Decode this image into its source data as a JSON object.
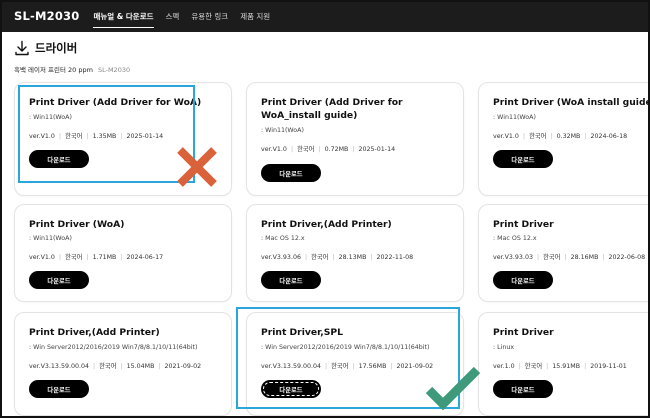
{
  "nav": {
    "brand": "SL-M2030",
    "items": [
      "매뉴얼 & 다운로드",
      "스펙",
      "유용한 링크",
      "제품 지원"
    ]
  },
  "section": {
    "title": "드라이버",
    "icon": "download-icon",
    "subtitle": "흑백 레이저 프린터 20 ppm",
    "model": "SL-M2030"
  },
  "cards": [
    {
      "title": "Print Driver (Add Driver for WoA)",
      "os": ": Win11(WoA)",
      "version": "ver.V1.0",
      "lang": "한국어",
      "size": "1.35MB",
      "date": "2025-01-14",
      "button": "다운로드"
    },
    {
      "title": "Print Driver (Add Driver for WoA_install guide)",
      "os": ": Win11(WoA)",
      "version": "ver.V1.0",
      "lang": "한국어",
      "size": "0.72MB",
      "date": "2025-01-14",
      "button": "다운로드"
    },
    {
      "title": "Print Driver (WoA install guide)",
      "os": ": Win11(WoA)",
      "version": "ver.V1.0",
      "lang": "한국어",
      "size": "0.32MB",
      "date": "2024-06-18",
      "button": "다운로드"
    },
    {
      "title": "Print Driver (WoA)",
      "os": ": Win11(WoA)",
      "version": "ver.V1.0",
      "lang": "한국어",
      "size": "1.71MB",
      "date": "2024-06-17",
      "button": "다운로드"
    },
    {
      "title": "Print Driver,(Add Printer)",
      "os": ": Mac OS 12.x",
      "version": "ver.V3.93.06",
      "lang": "한국어",
      "size": "28.13MB",
      "date": "2022-11-08",
      "button": "다운로드"
    },
    {
      "title": "Print Driver",
      "os": ": Mac OS 12.x",
      "version": "ver.V3.93.03",
      "lang": "한국어",
      "size": "28.16MB",
      "date": "2022-06-08",
      "button": "다운로드"
    },
    {
      "title": "Print Driver,(Add Printer)",
      "os": ": Win Server2012/2016/2019 Win7/8/8.1/10/11(64bit)",
      "version": "ver.V3.13.59.00.04",
      "lang": "한국어",
      "size": "15.04MB",
      "date": "2021-09-02",
      "button": "다운로드"
    },
    {
      "title": "Print Driver,SPL",
      "os": ": Win Server2012/2016/2019 Win7/8/8.1/10/11(64bit)",
      "version": "ver.V3.13.59.00.04",
      "lang": "한국어",
      "size": "17.56MB",
      "date": "2021-09-02",
      "button": "다운로드"
    },
    {
      "title": "Print Driver",
      "os": ": Linux",
      "version": "ver.1.0",
      "lang": "한국어",
      "size": "15.91MB",
      "date": "2019-11-01",
      "button": "다운로드"
    }
  ],
  "annotations": {
    "highlight_color": "#2aa6da",
    "wrong_mark_color": "#d9623b",
    "right_mark_color": "#3f9a7c"
  }
}
